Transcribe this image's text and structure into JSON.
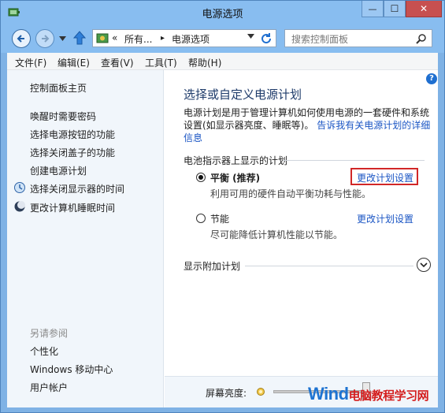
{
  "window": {
    "title": "电源选项",
    "controls": {
      "minimize": "—",
      "maximize": "☐",
      "close": "✕"
    }
  },
  "address": {
    "overflow": "«",
    "crumb1": "所有...",
    "separator": "▸",
    "crumb2": "电源选项",
    "search_placeholder": "搜索控制面板"
  },
  "menu": [
    "文件(F)",
    "编辑(E)",
    "查看(V)",
    "工具(T)",
    "帮助(H)"
  ],
  "sidebar": {
    "home": "控制面板主页",
    "links": [
      "唤醒时需要密码",
      "选择电源按钮的功能",
      "选择关闭盖子的功能",
      "创建电源计划",
      "选择关闭显示器的时间",
      "更改计算机睡眠时间"
    ],
    "see_also_title": "另请参阅",
    "see_also": [
      "个性化",
      "Windows 移动中心",
      "用户帐户"
    ]
  },
  "main": {
    "help": "?",
    "heading": "选择或自定义电源计划",
    "desc_lines": [
      "电源计划是用于管理计算机如何使用电源的一套硬件和系统",
      "设置(如显示器亮度、睡眠等)。"
    ],
    "desc_link_lines": [
      "告诉我有关电源计划的详细",
      "信息"
    ],
    "section_label": "电池指示器上显示的计划",
    "plans": [
      {
        "name": "平衡 (推荐)",
        "desc": "利用可用的硬件自动平衡功耗与性能。",
        "selected": true,
        "link": "更改计划设置"
      },
      {
        "name": "节能",
        "desc": "尽可能降低计算机性能以节能。",
        "selected": false,
        "link": "更改计划设置"
      }
    ],
    "extra_plans": "显示附加计划",
    "brightness_label": "屏幕亮度:",
    "brightness_level": 0.95
  },
  "watermark": {
    "part1": "Wind",
    "part2": "电脑教程学习网"
  },
  "colors": {
    "link": "#1a55c4",
    "highlight_box": "#d12727",
    "heading": "#1e3b6a"
  }
}
